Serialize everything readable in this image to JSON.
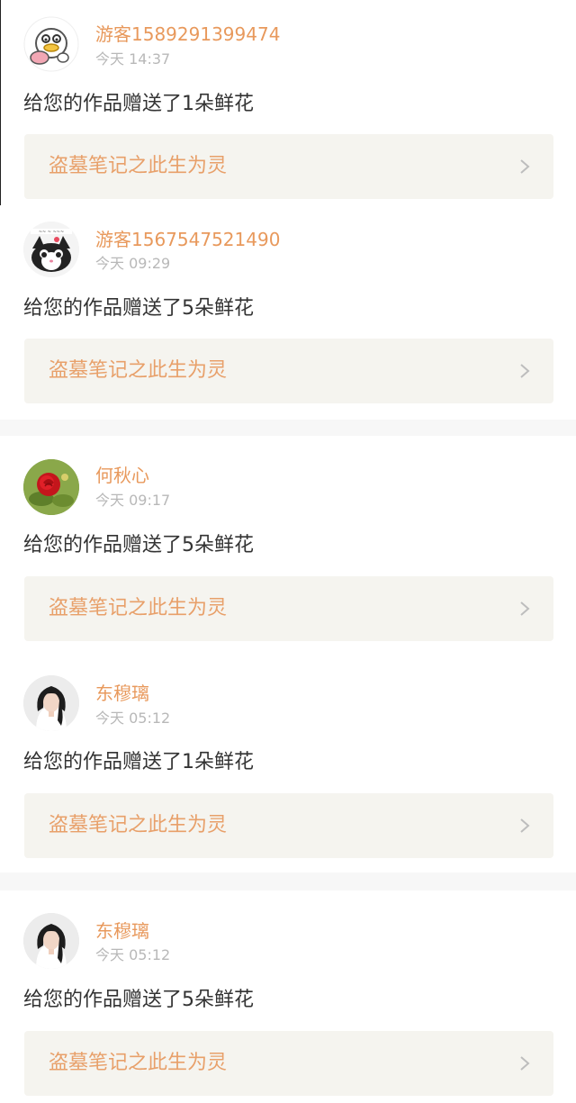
{
  "colors": {
    "accent": "#e8995c",
    "time_text": "#b8b8b8",
    "message_text": "#333333",
    "link_background": "#f5f4ef",
    "divider": "#f7f7f7"
  },
  "notifications": [
    {
      "avatar_icon": "duck-cartoon-avatar",
      "username": "游客1589291399474",
      "time": "今天 14:37",
      "message": "给您的作品赠送了1朵鲜花",
      "work_title": "盗墓笔记之此生为灵"
    },
    {
      "avatar_icon": "cat-cartoon-avatar",
      "username": "游客1567547521490",
      "time": "今天 09:29",
      "message": "给您的作品赠送了5朵鲜花",
      "work_title": "盗墓笔记之此生为灵"
    },
    {
      "avatar_icon": "red-rose-avatar",
      "username": "何秋心",
      "time": "今天 09:17",
      "message": "给您的作品赠送了5朵鲜花",
      "work_title": "盗墓笔记之此生为灵"
    },
    {
      "avatar_icon": "girl-portrait-avatar",
      "username": "东穆璃",
      "time": "今天 05:12",
      "message": "给您的作品赠送了1朵鲜花",
      "work_title": "盗墓笔记之此生为灵"
    },
    {
      "avatar_icon": "girl-portrait-avatar",
      "username": "东穆璃",
      "time": "今天 05:12",
      "message": "给您的作品赠送了5朵鲜花",
      "work_title": "盗墓笔记之此生为灵"
    }
  ]
}
